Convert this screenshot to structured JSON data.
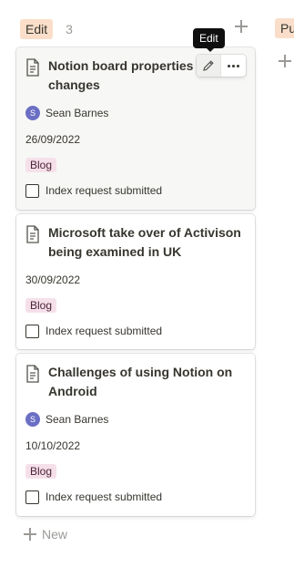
{
  "column": {
    "group_label": "Edit",
    "count": "3",
    "new_label": "New"
  },
  "next_column": {
    "group_label_fragment": "Pu"
  },
  "tooltip": {
    "text": "Edit"
  },
  "cards": [
    {
      "title": "Notion board properties e... changes",
      "title_line1": "Notion board properties e",
      "title_line2": "changes",
      "person": "Sean Barnes",
      "avatar_initial": "S",
      "date": "26/09/2022",
      "tag": "Blog",
      "checkbox_label": "Index request submitted",
      "checked": false
    },
    {
      "title_line1": "Microsoft take over of Activison",
      "title_line2": "being examined in UK",
      "date": "30/09/2022",
      "tag": "Blog",
      "checkbox_label": "Index request submitted",
      "checked": false
    },
    {
      "title_line1": "Challenges of using Notion on",
      "title_line2": "Android",
      "person": "Sean Barnes",
      "avatar_initial": "S",
      "date": "10/10/2022",
      "tag": "Blog",
      "checkbox_label": "Index request submitted",
      "checked": false
    }
  ],
  "icons": {
    "page": "document-icon",
    "edit": "pencil-icon",
    "more": "more-dots-icon",
    "add": "plus-icon"
  },
  "colors": {
    "group_tag_bg": "#fadec9",
    "blog_tag_bg": "#f5e0e9",
    "avatar_bg": "#6b6fc4",
    "tooltip_bg": "#0f0f0f"
  }
}
